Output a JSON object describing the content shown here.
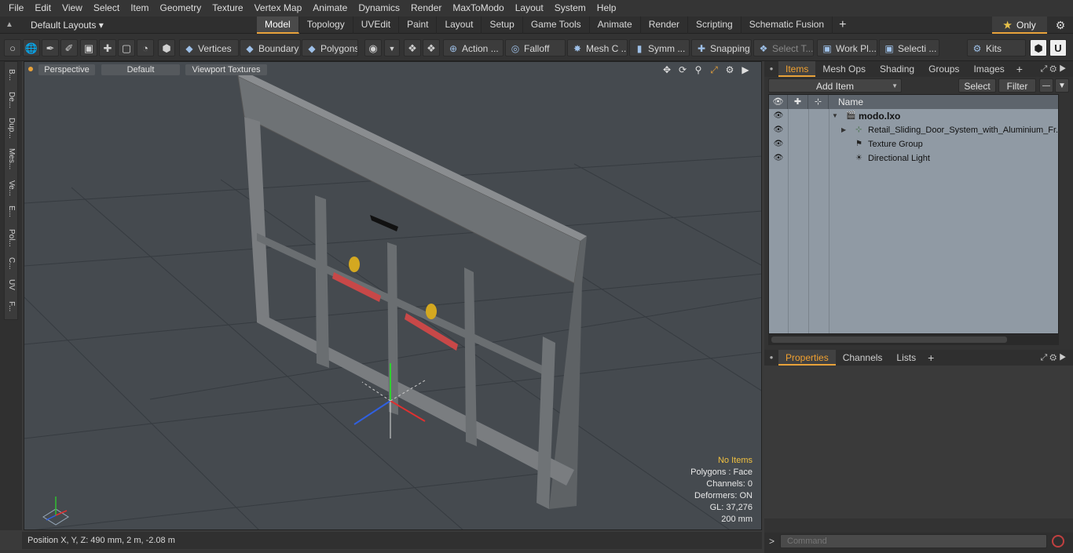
{
  "menu": [
    "File",
    "Edit",
    "View",
    "Select",
    "Item",
    "Geometry",
    "Texture",
    "Vertex Map",
    "Animate",
    "Dynamics",
    "Render",
    "MaxToModo",
    "Layout",
    "System",
    "Help"
  ],
  "layoutbar": {
    "layout_name": "Default Layouts ▾",
    "tabs": [
      "Model",
      "Topology",
      "UVEdit",
      "Paint",
      "Layout",
      "Setup",
      "Game Tools",
      "Animate",
      "Render",
      "Scripting",
      "Schematic Fusion"
    ],
    "active_tab": "Model",
    "only_label": "Only"
  },
  "toolbar": {
    "vertices": "Vertices",
    "boundary": "Boundary",
    "polygons": "Polygons",
    "action": "Action",
    "falloff": "Falloff",
    "meshc": "Mesh C ...",
    "symm": "Symm ...",
    "snapping": "Snapping",
    "selectt": "Select T...",
    "workpl": "Work Pl...",
    "selecti": "Selecti ...",
    "kits": "Kits"
  },
  "left_tabs": [
    "B...",
    "De...",
    "Dup...",
    "Mes...",
    "Ve...",
    "E...",
    "Pol...",
    "C...",
    "UV",
    "F..."
  ],
  "viewport": {
    "view_mode": "Perspective",
    "shading": "Default",
    "textures": "Viewport Textures",
    "info": {
      "selection": "No Items",
      "polygons": "Polygons : Face",
      "channels": "Channels: 0",
      "deformers": "Deformers: ON",
      "gl": "GL: 37,276",
      "scale": "200 mm"
    }
  },
  "status": {
    "position": "Position X, Y, Z:   490 mm, 2 m, -2.08 m"
  },
  "items_panel": {
    "tabs": [
      "Items",
      "Mesh Ops",
      "Shading",
      "Groups",
      "Images"
    ],
    "active_tab": "Items",
    "add_item": "Add Item",
    "select": "Select",
    "filter": "Filter",
    "name_col": "Name",
    "tree": [
      {
        "label": "modo.lxo",
        "bold": true
      },
      {
        "label": "Retail_Sliding_Door_System_with_Aluminium_Fr..."
      },
      {
        "label": "Texture Group"
      },
      {
        "label": "Directional Light"
      }
    ]
  },
  "properties_panel": {
    "tabs": [
      "Properties",
      "Channels",
      "Lists"
    ],
    "active_tab": "Properties"
  },
  "command": {
    "placeholder": "Command"
  }
}
